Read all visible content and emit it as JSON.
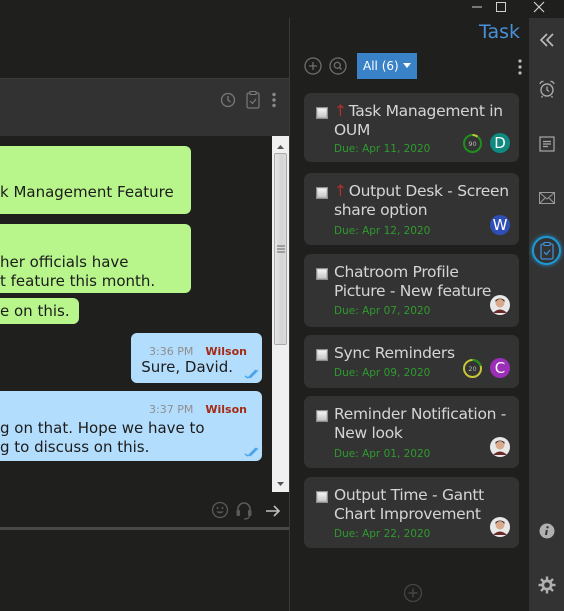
{
  "window": {
    "controls": {
      "minimize": "minimize",
      "maximize": "maximize",
      "close": "close"
    }
  },
  "chat": {
    "header_icons": [
      "clock-icon",
      "clipboard-check-icon",
      "more-vertical-icon"
    ],
    "messages": [
      {
        "type": "received",
        "lines": [
          "k Management Feature"
        ]
      },
      {
        "type": "received",
        "lines": [
          "her officials have",
          "t feature this month."
        ]
      },
      {
        "type": "received",
        "lines": [
          "e on this."
        ]
      },
      {
        "type": "sent",
        "time": "3:36 PM",
        "sender": "Wilson",
        "lines": [
          "Sure, David."
        ]
      },
      {
        "type": "sent",
        "time": "3:37 PM",
        "sender": "Wilson",
        "lines": [
          "g on that. Hope we have to",
          "g to discuss on this."
        ]
      }
    ],
    "input_icons": [
      "emoji-icon",
      "headset-icon",
      "send-arrow-icon"
    ]
  },
  "task_panel": {
    "title": "Task",
    "filter": {
      "selected": "All (6)"
    },
    "tasks": [
      {
        "title": "Task Management in OUM",
        "priority_high": true,
        "due": "Due: Apr 11, 2020",
        "progress": 90,
        "progress_label": "90",
        "assignee": {
          "initial": "D",
          "color": "#0f8a80"
        }
      },
      {
        "title": "Output Desk - Screen share option",
        "priority_high": true,
        "due": "Due: Apr 12, 2020",
        "progress": null,
        "assignee": {
          "initial": "W",
          "color": "#2f4fb8"
        }
      },
      {
        "title": "Chatroom Profile Picture - New feature",
        "priority_high": false,
        "due": "Due: Apr 07, 2020",
        "progress": null,
        "assignee": {
          "photo": true
        }
      },
      {
        "title": "Sync Reminders",
        "priority_high": false,
        "due": "Due: Apr 09, 2020",
        "progress": 20,
        "progress_label": "20",
        "assignee": {
          "initial": "C",
          "color": "#9b2fb8"
        }
      },
      {
        "title": "Reminder Notification -  New look",
        "priority_high": false,
        "due": "Due: Apr 01, 2020",
        "progress": null,
        "assignee": {
          "photo": true
        }
      },
      {
        "title": "Output Time - Gantt Chart Improvement",
        "priority_high": false,
        "due": "Due: Apr 22, 2020",
        "progress": null,
        "assignee": {
          "photo": true
        }
      }
    ],
    "priority_glyph": "↑"
  },
  "sidebar": {
    "items": [
      "collapse-icon",
      "alarm-icon",
      "notes-icon",
      "mail-icon",
      "tasks-icon",
      "info-icon",
      "settings-icon"
    ],
    "active": "tasks-icon"
  }
}
